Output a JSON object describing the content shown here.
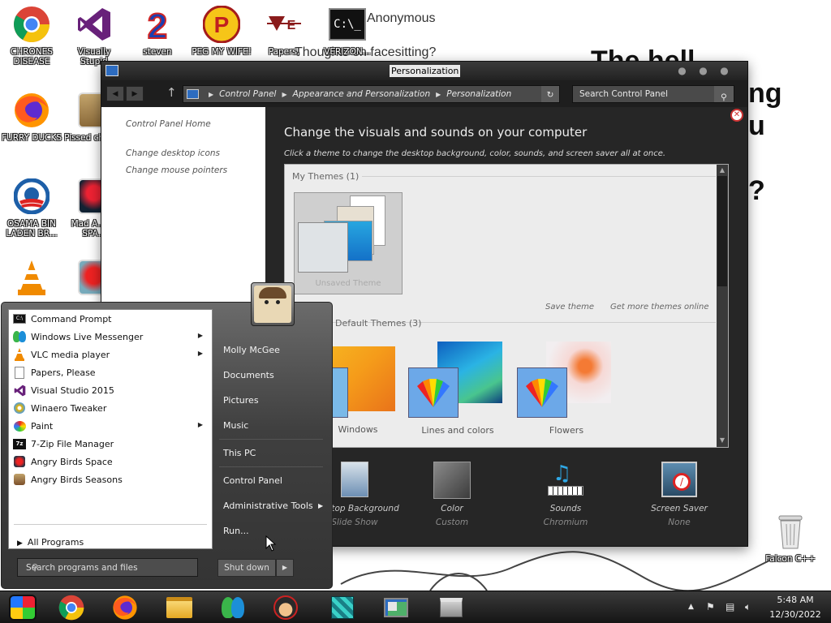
{
  "desktop": {
    "bg_texts": {
      "anonymous": "Anonymous",
      "question": "Thoughts on facesitting?",
      "line1": "The hell",
      "line2": "ng",
      "line3": "u",
      "qmark": "?"
    },
    "icons": [
      {
        "label": "CHRONES DISEASE",
        "icon": "chrome-icon"
      },
      {
        "label": "Visually Stupid",
        "icon": "visual-studio-icon"
      },
      {
        "label": "steven",
        "icon": "number-two-icon"
      },
      {
        "label": "PEG MY WIFE!",
        "icon": "p-logo-icon"
      },
      {
        "label": "Papers,",
        "icon": "papers-please-icon"
      },
      {
        "label": "VERIZON...",
        "icon": "cmd-icon"
      },
      {
        "label": "FURRY DUCKS",
        "icon": "firefox-icon"
      },
      {
        "label": "Pissed chick...",
        "icon": "angry-birds-seasons-icon"
      },
      {
        "label": "OSAMA BIN LADEN BR...",
        "icon": "obama-logo-icon"
      },
      {
        "label": "Mad A... IN SPA...",
        "icon": "angry-birds-space-icon"
      },
      {
        "label": "",
        "icon": "vlc-icon"
      },
      {
        "label": "",
        "icon": "angry-birds-icon"
      },
      {
        "label": "Falcon C++",
        "icon": "recycle-bin-icon"
      }
    ]
  },
  "window": {
    "title": "Personalization",
    "address": [
      "Control Panel",
      "Appearance and Personalization",
      "Personalization"
    ],
    "search_placeholder": "Search Control Panel",
    "left_links": {
      "home": "Control Panel Home",
      "desktop_icons": "Change desktop icons",
      "mouse_pointers": "Change mouse pointers"
    },
    "heading": "Change the visuals and sounds on your computer",
    "subheading": "Click a theme to change the desktop background, color, sounds, and screen saver all at once.",
    "my_themes_group": "My Themes (1)",
    "my_theme_name": "Unsaved Theme",
    "save_theme": "Save theme",
    "get_more": "Get more themes online",
    "default_group": "Default Themes (3)",
    "default_themes": [
      "Windows",
      "Lines and colors",
      "Flowers"
    ],
    "bottom": [
      {
        "label": "Desktop Background",
        "value": "Slide Show",
        "icon": "desktop-background-icon"
      },
      {
        "label": "Color",
        "value": "Custom",
        "icon": "color-swatch-icon"
      },
      {
        "label": "Sounds",
        "value": "Chromium",
        "icon": "sounds-icon"
      },
      {
        "label": "Screen Saver",
        "value": "None",
        "icon": "screen-saver-icon"
      }
    ]
  },
  "start_menu": {
    "programs": [
      {
        "label": "Command Prompt",
        "icon": "cmd-icon",
        "arrow": false
      },
      {
        "label": "Windows Live Messenger",
        "icon": "messenger-icon",
        "arrow": true
      },
      {
        "label": "VLC media player",
        "icon": "vlc-icon",
        "arrow": true
      },
      {
        "label": "Papers, Please",
        "icon": "document-icon",
        "arrow": false
      },
      {
        "label": "Visual Studio 2015",
        "icon": "visual-studio-icon",
        "arrow": false
      },
      {
        "label": "Winaero Tweaker",
        "icon": "winaero-icon",
        "arrow": false
      },
      {
        "label": "Paint",
        "icon": "paint-icon",
        "arrow": true
      },
      {
        "label": "7-Zip File Manager",
        "icon": "seven-zip-icon",
        "arrow": false
      },
      {
        "label": "Angry Birds Space",
        "icon": "angry-birds-space-icon",
        "arrow": false
      },
      {
        "label": "Angry Birds Seasons",
        "icon": "angry-birds-seasons-icon",
        "arrow": false
      }
    ],
    "all_programs": "All Programs",
    "search_placeholder": "Search programs and files",
    "right_items": {
      "user": "Molly McGee",
      "documents": "Documents",
      "pictures": "Pictures",
      "music": "Music",
      "this_pc": "This PC",
      "control_panel": "Control Panel",
      "admin_tools": "Administrative Tools",
      "run": "Run..."
    },
    "shutdown": "Shut down"
  },
  "taskbar": {
    "pinned": [
      "start-orb-icon",
      "chrome-icon",
      "firefox-icon",
      "file-explorer-icon",
      "messenger-icon",
      "game-character-icon",
      "pixel-game-icon",
      "control-panel-icon",
      "cabinet-icon"
    ],
    "time": "5:48 AM",
    "date": "12/30/2022"
  }
}
